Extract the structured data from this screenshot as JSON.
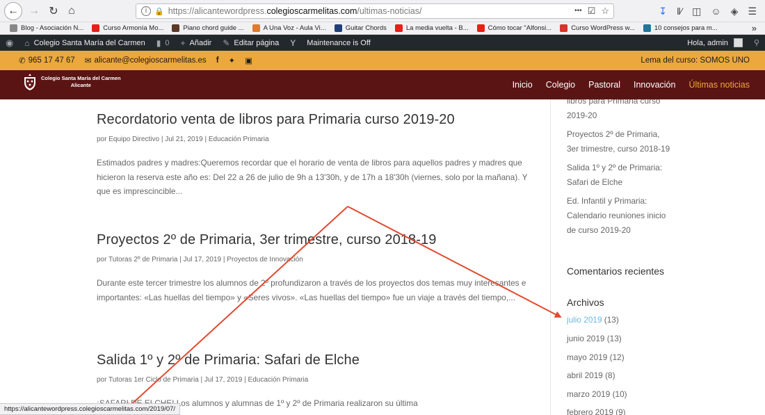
{
  "browser": {
    "url_proto": "https://",
    "url_host_prefix": "alicantewordpress.",
    "url_host": "colegioscarmelitas.com",
    "url_path": "/ultimas-noticias/",
    "more_label": "•••",
    "status_url": "https://alicantewordpress.colegioscarmelitas.com/2019/07/"
  },
  "bookmarks": [
    {
      "label": "Blog - Asociación N...",
      "color": "#888888"
    },
    {
      "label": "Curso Armonía Mo...",
      "color": "#e62117"
    },
    {
      "label": "Piano chord guide ...",
      "color": "#5b3a29"
    },
    {
      "label": "A Una Voz - Aula Vi...",
      "color": "#e07a28"
    },
    {
      "label": "Guitar Chords",
      "color": "#1f3f7a"
    },
    {
      "label": "La media vuelta - B...",
      "color": "#e62117"
    },
    {
      "label": "Cómo tocar \"Alfonsi...",
      "color": "#e62117"
    },
    {
      "label": "Curso WordPress w...",
      "color": "#d9342b"
    },
    {
      "label": "10 consejos para m...",
      "color": "#21759b"
    }
  ],
  "adminbar": {
    "site_name": "Colegio Santa María del Carmen",
    "comments": "0",
    "add_new": "Añadir",
    "edit_page": "Editar página",
    "maintenance": "Maintenance is Off",
    "greeting": "Hola, admin"
  },
  "topheader": {
    "phone": "965 17 47 67",
    "email": "alicante@colegioscarmelitas.es",
    "lema": "Lema del curso: SOMOS UNO"
  },
  "logo": {
    "line1": "Colegio Santa María del Carmen",
    "line2": "Alicante"
  },
  "menu": {
    "inicio": "Inicio",
    "colegio": "Colegio",
    "pastoral": "Pastoral",
    "innovacion": "Innovación",
    "ultimas": "Últimas noticias"
  },
  "posts": [
    {
      "title": "Recordatorio venta de libros para Primaria curso 2019-20",
      "meta": "por Equipo Directivo | Jul 21, 2019 | Educación Primaria",
      "excerpt": "Estimados padres y madres:Queremos recordar que el horario de venta de libros para aquellos padres y madres que hicieron la reserva este año es: Del 22 a 26 de julio de 9h a 13'30h, y de 17h a 18'30h (viernes, solo por la mañana). Y que es imprescincible..."
    },
    {
      "title": "Proyectos 2º de Primaria, 3er trimestre, curso 2018-19",
      "meta": "por Tutoras 2º de Primaria | Jul 17, 2019 | Proyectos de Innovación",
      "excerpt": "Durante este tercer trimestre los alumnos de 2º profundizaron a través de los proyectos dos temas muy interesantes e importantes: «Las huellas del tiempo» y «Seres vivos». «Las huellas del tiempo» fue un viaje a través del tiempo,..."
    },
    {
      "title": "Salida 1º y 2º de Primaria: Safari de Elche",
      "meta": "por Tutoras 1er Ciclo de Primaria | Jul 17, 2019 | Educación Primaria",
      "excerpt": "¡SAFARI DE ELCHE! Los alumnos y alumnas de 1º y 2º de Primaria realizaron su última"
    }
  ],
  "sidebar": {
    "recent_cut": "libros para Primaria curso 2019-20",
    "recent_2": "Proyectos 2º de Primaria, 3er trimestre, curso 2018-19",
    "recent_3": "Salida 1º y 2º de Primaria: Safari de Elche",
    "recent_4": "Ed. Infantil y Primaria: Calendario reuniones inicio de curso 2019-20",
    "comments_heading": "Comentarios recientes",
    "archives_heading": "Archivos",
    "archives": [
      {
        "month": "julio 2019",
        "count": "(13)"
      },
      {
        "month": "junio 2019",
        "count": "(13)"
      },
      {
        "month": "mayo 2019",
        "count": "(12)"
      },
      {
        "month": "abril 2019",
        "count": "(8)"
      },
      {
        "month": "marzo 2019",
        "count": "(10)"
      },
      {
        "month": "febrero 2019",
        "count": "(9)"
      }
    ]
  },
  "colors": {
    "orange": "#eca83c",
    "maroon": "#5a1414",
    "admin_bar": "#23282d",
    "link_hover": "#6ab8e0",
    "annotation_arrow": "#e2492f"
  }
}
